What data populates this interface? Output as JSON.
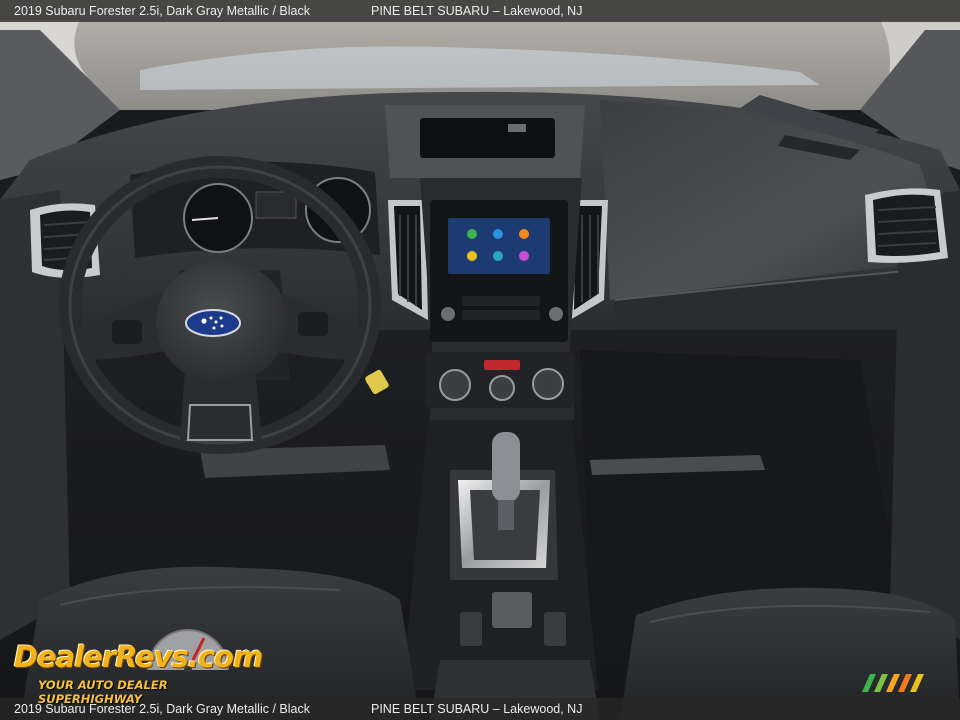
{
  "caption": {
    "vehicle": "2019 Subaru Forester 2.5i",
    "exterior_color": "Dark Gray Metallic",
    "interior_color": "Black",
    "dealer": "PINE BELT SUBARU",
    "location": "Lakewood, NJ"
  },
  "watermark": {
    "brand": "DealerRevs.com",
    "tagline": "YOUR AUTO DEALER SUPERHIGHWAY"
  },
  "colors": {
    "caption_bar": "#282828",
    "dash": "#34363a",
    "floor": "#1c1d20",
    "watermark_gold": "#f2b21a",
    "subaru_badge": "#1c3b8c"
  }
}
